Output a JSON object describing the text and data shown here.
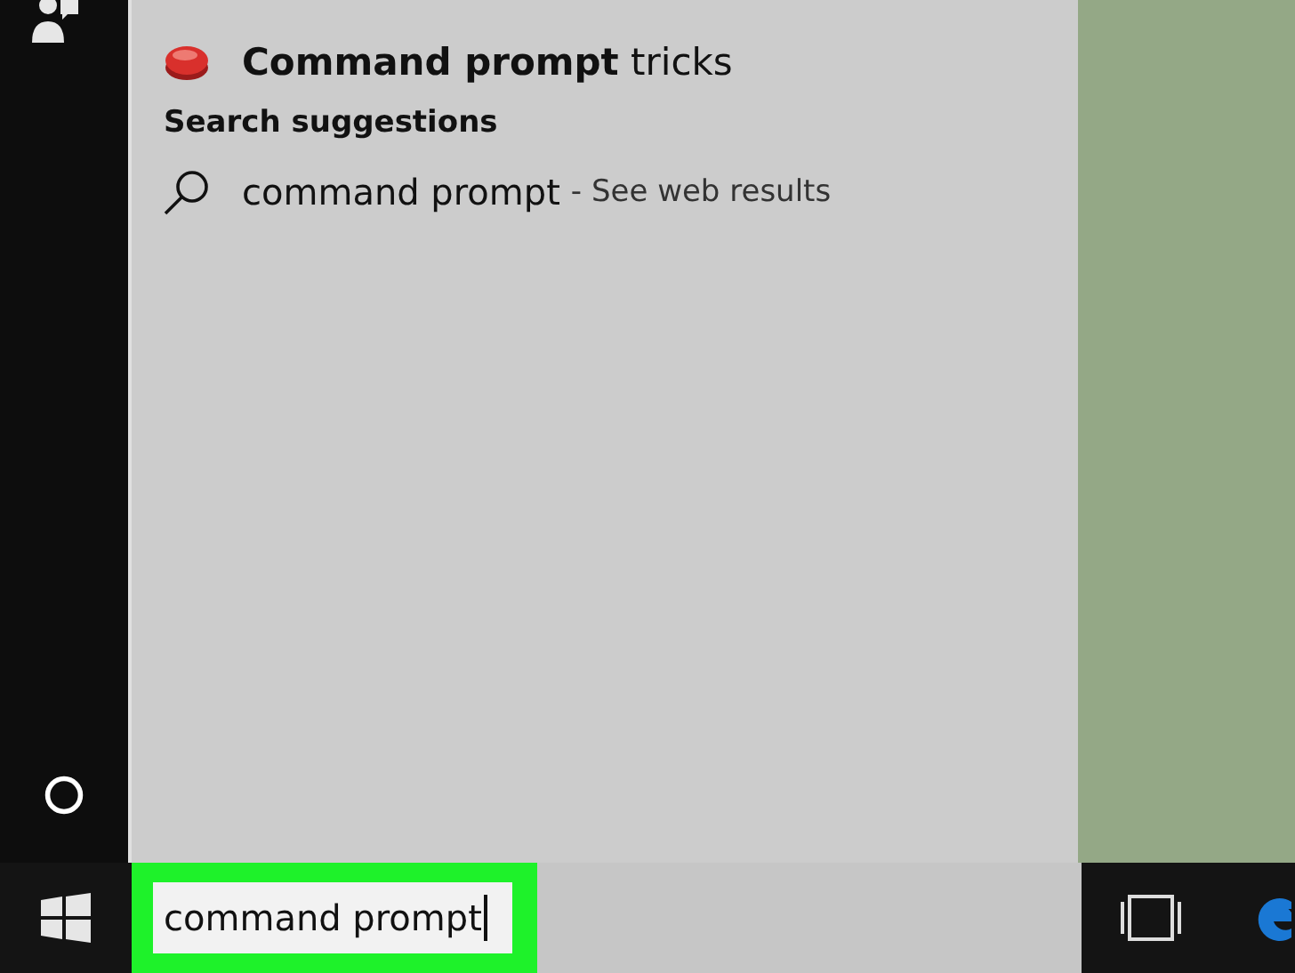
{
  "results": {
    "store_item": {
      "title": "**Command prompt** tricks"
    },
    "section_suggestions": "Search suggestions",
    "suggestion": {
      "query": "command prompt",
      "hint": "- See web results"
    }
  },
  "search": {
    "value": "command prompt",
    "highlighted": true
  }
}
